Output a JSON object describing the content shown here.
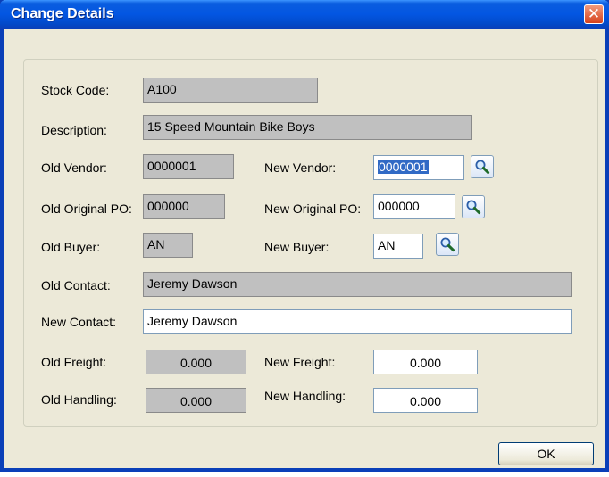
{
  "window": {
    "title": "Change Details",
    "close_glyph": "✕"
  },
  "form": {
    "stock_code": {
      "label": "Stock Code:",
      "value": "A100"
    },
    "description": {
      "label": "Description:",
      "value": "15 Speed Mountain Bike Boys"
    },
    "old_vendor": {
      "label": "Old Vendor:",
      "value": "0000001"
    },
    "new_vendor": {
      "label": "New Vendor:",
      "value": "0000001"
    },
    "old_original_po": {
      "label": "Old Original PO:",
      "value": "000000"
    },
    "new_original_po": {
      "label": "New Original PO:",
      "value": "000000"
    },
    "old_buyer": {
      "label": "Old Buyer:",
      "value": "AN"
    },
    "new_buyer": {
      "label": "New Buyer:",
      "value": "AN"
    },
    "old_contact": {
      "label": "Old Contact:",
      "value": "Jeremy Dawson"
    },
    "new_contact": {
      "label": "New Contact:",
      "value": "Jeremy Dawson"
    },
    "old_freight": {
      "label": "Old Freight:",
      "value": "0.000"
    },
    "new_freight": {
      "label": "New Freight:",
      "value": "0.000"
    },
    "old_handling": {
      "label": "Old Handling:",
      "value": "0.000"
    },
    "new_handling": {
      "label": "New Handling:",
      "value": "0.000"
    }
  },
  "buttons": {
    "ok_label": "OK"
  },
  "icons": {
    "lookup": "magnifier-icon",
    "close": "close-icon"
  },
  "colors": {
    "title_bar": "#0356e2",
    "window_bg": "#ece9d8",
    "readonly_bg": "#c0c0c0",
    "selection": "#316ac5",
    "close_button": "#d6411c"
  }
}
